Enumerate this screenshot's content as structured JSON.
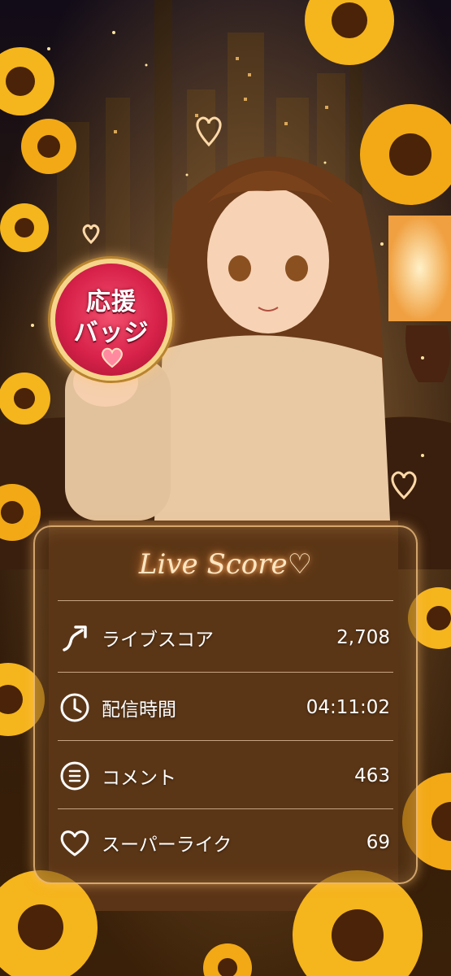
{
  "badge": {
    "line1": "応援",
    "line2": "バッジ"
  },
  "live_score": {
    "title": "Live Score♡",
    "rows": [
      {
        "icon": "trending-up-arrow-icon",
        "label": "ライブスコア",
        "value": "2,708"
      },
      {
        "icon": "clock-icon",
        "label": "配信時間",
        "value": "04:11:02"
      },
      {
        "icon": "comment-list-icon",
        "label": "コメント",
        "value": "463"
      },
      {
        "icon": "heart-icon",
        "label": "スーパーライク",
        "value": "69"
      }
    ]
  },
  "colors": {
    "badge_red": "#d8224a",
    "badge_gold": "#f6d58a",
    "panel_border": "#ffcd8c",
    "title_glow": "#ffb36b",
    "sunflower": "#f5b51c"
  }
}
